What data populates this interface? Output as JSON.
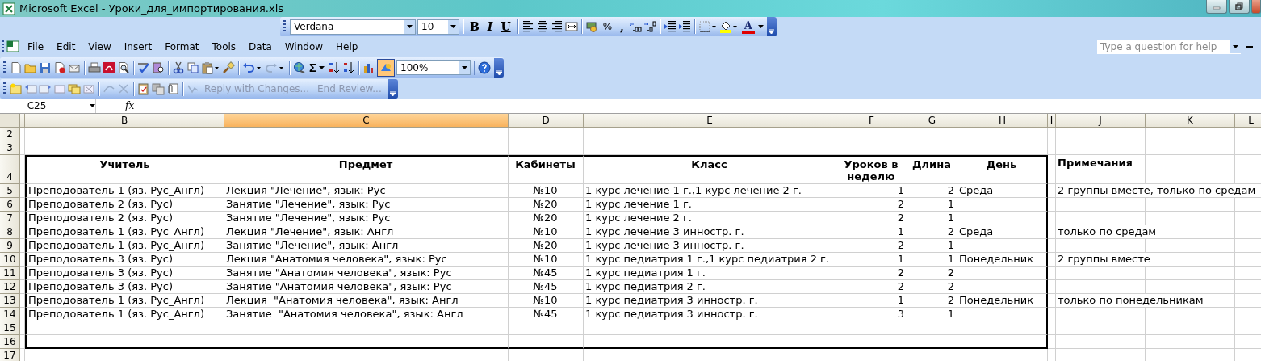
{
  "window": {
    "title": "Microsoft Excel - Уроки_для_импортирования.xls"
  },
  "formatting_toolbar": {
    "font": "Verdana",
    "size": "10",
    "bold": "B",
    "italic": "I",
    "underline": "U",
    "percent": "%",
    "comma": ",",
    "font_color": "A"
  },
  "menu": [
    "File",
    "Edit",
    "View",
    "Insert",
    "Format",
    "Tools",
    "Data",
    "Window",
    "Help"
  ],
  "help": {
    "placeholder": "Type a question for help"
  },
  "standard_toolbar": {
    "sum": "Σ",
    "zoom": "100%",
    "drawing_selected": true
  },
  "reviewing_toolbar": {
    "buttons": [
      {
        "label": "Reply with Changes...",
        "disabled": true
      },
      {
        "label": "End Review...",
        "disabled": true
      }
    ]
  },
  "formula_bar": {
    "name_box": "C25",
    "function_label": "fx"
  },
  "columns": [
    {
      "selected": false
    },
    {
      "label": "B",
      "selected": false
    },
    {
      "label": "C",
      "selected": true
    },
    {
      "label": "D",
      "selected": false
    },
    {
      "label": "E",
      "selected": false
    },
    {
      "label": "F",
      "selected": false
    },
    {
      "label": "G",
      "selected": false
    },
    {
      "label": "H",
      "selected": false
    },
    {
      "label": "I",
      "selected": false
    },
    {
      "label": "J",
      "selected": false
    },
    {
      "label": "K",
      "selected": false
    },
    {
      "label": "L",
      "selected": false
    }
  ],
  "rows": [
    {
      "number": "2",
      "kind": "blank",
      "boxed": false
    },
    {
      "number": "3",
      "kind": "blank",
      "boxed": false
    },
    {
      "number": "4",
      "kind": "header",
      "boxed": true,
      "cells": [
        null,
        "Учитель",
        "Предмет",
        "Кабинеты",
        "Класс",
        "Уроков в неделю",
        "Длина",
        "День",
        null,
        "Примечания"
      ]
    },
    {
      "number": "5",
      "kind": "data",
      "boxed": true,
      "cells": [
        null,
        "Преподователь 1 (яз. Рус_Англ)",
        "Лекция \"Лечение\", язык: Рус",
        "№10",
        "1 курс лечение 1 г.,1 курс лечение 2 г.",
        "1",
        "2",
        "Среда",
        null,
        "2 группы вместе, только по средам"
      ]
    },
    {
      "number": "6",
      "kind": "data",
      "boxed": true,
      "cells": [
        null,
        "Преподователь 2 (яз. Рус)",
        "Занятие \"Лечение\", язык: Рус",
        "№20",
        "1 курс лечение 1 г.",
        "2",
        "1"
      ]
    },
    {
      "number": "7",
      "kind": "data",
      "boxed": true,
      "cells": [
        null,
        "Преподователь 2 (яз. Рус)",
        "Занятие \"Лечение\", язык: Рус",
        "№20",
        "1 курс лечение 2 г.",
        "2",
        "1"
      ]
    },
    {
      "number": "8",
      "kind": "data",
      "boxed": true,
      "cells": [
        null,
        "Преподователь 1 (яз. Рус_Англ)",
        "Лекция \"Лечение\", язык: Англ",
        "№10",
        "1 курс лечение 3 инностр. г.",
        "1",
        "2",
        "Среда",
        null,
        "только по средам"
      ]
    },
    {
      "number": "9",
      "kind": "data",
      "boxed": true,
      "cells": [
        null,
        "Преподователь 1 (яз. Рус_Англ)",
        "Занятие \"Лечение\", язык: Англ",
        "№20",
        "1 курс лечение 3 инностр. г.",
        "2",
        "1"
      ]
    },
    {
      "number": "10",
      "kind": "data",
      "boxed": true,
      "cells": [
        null,
        "Преподователь 3 (яз. Рус)",
        "Лекция \"Анатомия человека\", язык: Рус",
        "№10",
        "1 курс педиатрия 1 г.,1 курс педиатрия 2 г.",
        "1",
        "1",
        "Понедельник",
        null,
        "2 группы вместе"
      ]
    },
    {
      "number": "11",
      "kind": "data",
      "boxed": true,
      "cells": [
        null,
        "Преподователь 3 (яз. Рус)",
        "Занятие \"Анатомия человека\", язык: Рус",
        "№45",
        "1 курс педиатрия 1 г.",
        "2",
        "2"
      ]
    },
    {
      "number": "12",
      "kind": "data",
      "boxed": true,
      "cells": [
        null,
        "Преподователь 3 (яз. Рус)",
        "Занятие \"Анатомия человека\", язык: Рус",
        "№45",
        "1 курс педиатрия 2 г.",
        "2",
        "2"
      ]
    },
    {
      "number": "13",
      "kind": "data",
      "boxed": true,
      "cells": [
        null,
        "Преподователь 1 (яз. Рус_Англ)",
        "Лекция  \"Анатомия человека\", язык: Англ",
        "№10",
        "1 курс педиатрия 3 инностр. г.",
        "1",
        "2",
        "Понедельник",
        null,
        "только по понедельникам"
      ]
    },
    {
      "number": "14",
      "kind": "data",
      "boxed": true,
      "cells": [
        null,
        "Преподователь 1 (яз. Рус_Англ)",
        "Занятие  \"Анатомия человека\", язык: Англ",
        "№45",
        "1 курс педиатрия 3 инностр. г.",
        "3",
        "1"
      ]
    },
    {
      "number": "15",
      "kind": "blank",
      "boxed": true
    },
    {
      "number": "16",
      "kind": "blank",
      "boxed": true
    },
    {
      "number": "17",
      "kind": "blank",
      "boxed": false
    }
  ]
}
